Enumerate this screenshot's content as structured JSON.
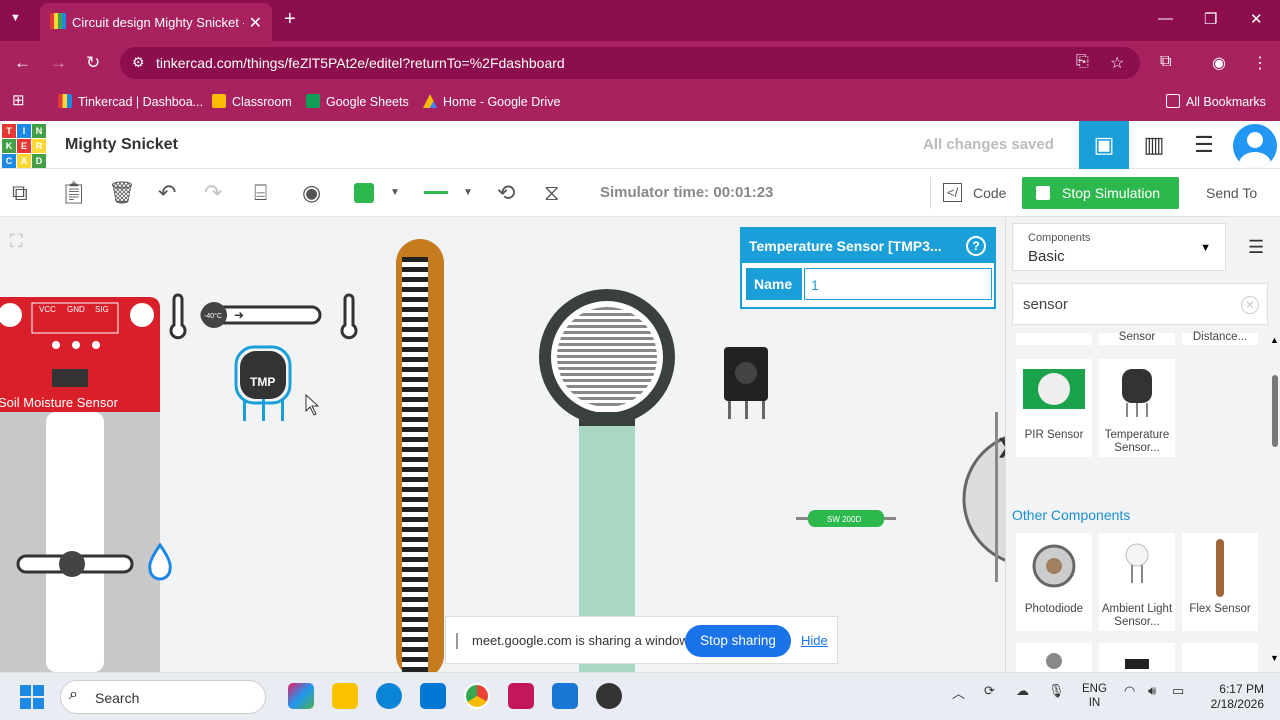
{
  "browser": {
    "tab_title": "Circuit design Mighty Snicket -",
    "url": "tinkercad.com/things/feZlT5PAt2e/editel?returnTo=%2Fdashboard",
    "bookmarks": [
      "Tinkercad | Dashboa...",
      "Classroom",
      "Google Sheets",
      "Home - Google Drive"
    ],
    "all_bookmarks": "All Bookmarks"
  },
  "app": {
    "logo_letters": [
      "T",
      "I",
      "N",
      "K",
      "E",
      "R",
      "C",
      "A",
      "D"
    ],
    "project_name": "Mighty Snicket",
    "save_status": "All changes saved"
  },
  "toolbar": {
    "simulator_time": "Simulator time: 00:01:23",
    "code_label": "Code",
    "stop_simulation_label": "Stop Simulation",
    "send_to_label": "Send To"
  },
  "canvas": {
    "soil_label": "Soil Moisture Sensor",
    "soil_pins": [
      "VCC",
      "GND",
      "SIG"
    ],
    "temp_readout": "-40°C",
    "tmp_label": "TMP",
    "resistor_label": "SW 200D"
  },
  "inspector": {
    "title": "Temperature Sensor [TMP3...",
    "name_label": "Name",
    "name_value": "1"
  },
  "share_bar": {
    "message": "meet.google.com is sharing a window.",
    "stop_label": "Stop sharing",
    "hide_label": "Hide"
  },
  "components_panel": {
    "category_caption": "Components",
    "category_value": "Basic",
    "search_value": "sensor",
    "partial_labels": [
      "Sensor",
      "Distance..."
    ],
    "items": [
      {
        "name": "PIR Sensor"
      },
      {
        "name": "Temperature Sensor..."
      }
    ],
    "other_heading": "Other Components",
    "other_items": [
      {
        "name": "Photodiode"
      },
      {
        "name": "Ambient Light Sensor..."
      },
      {
        "name": "Flex Sensor"
      }
    ]
  },
  "taskbar": {
    "search_placeholder": "Search",
    "lang_line1": "ENG",
    "lang_line2": "IN",
    "time": "6:17 PM",
    "date": "2/18/2026"
  },
  "colors": {
    "browser_frame": "#a8225f",
    "accent": "#1b9fd8",
    "stop_green": "#2db84d"
  }
}
